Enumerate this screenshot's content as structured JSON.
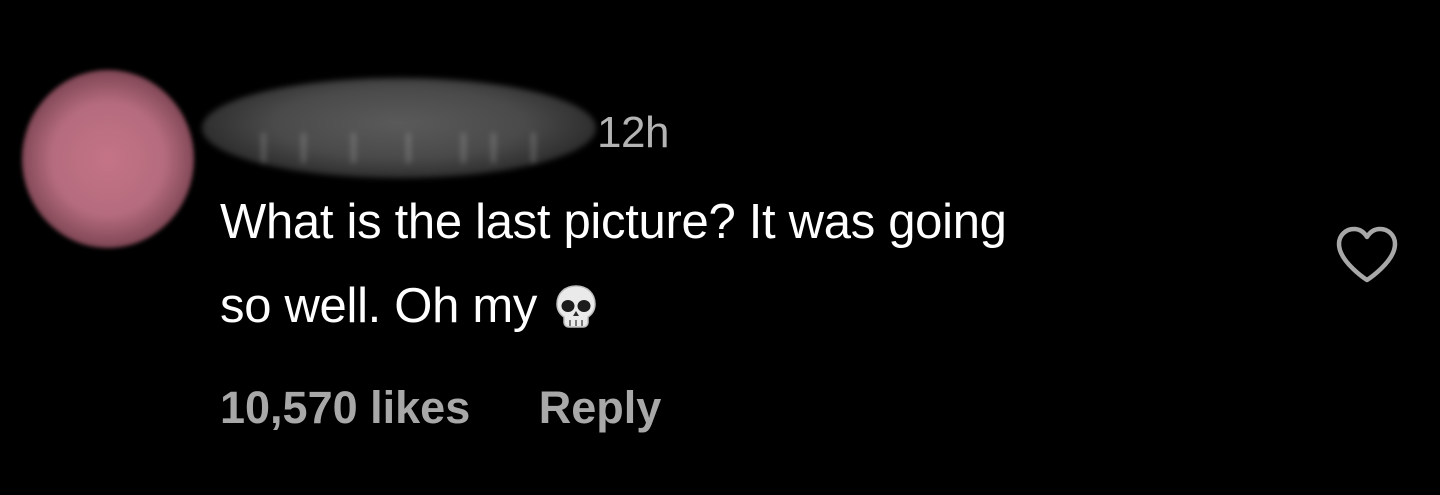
{
  "comment": {
    "timestamp": "12h",
    "text_line1": "What is the last picture? It was going",
    "text_line2": "so well. Oh my",
    "emoji": "skull-icon",
    "likes_label": "10,570 likes",
    "reply_label": "Reply",
    "like_icon": "heart-outline-icon"
  },
  "colors": {
    "background": "#000000",
    "text_primary": "#ffffff",
    "text_secondary": "#a8a8a8",
    "avatar": "#c47486"
  }
}
